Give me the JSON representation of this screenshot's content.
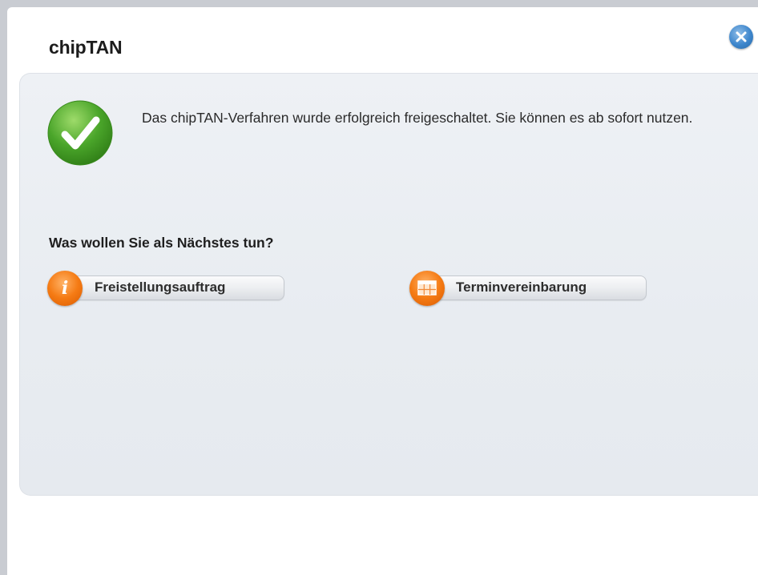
{
  "dialog": {
    "title": "chipTAN",
    "close_icon": "close-icon",
    "success_icon": "checkmark-icon",
    "message": "Das chipTAN-Verfahren wurde erfolgreich freigeschaltet. Sie können es ab sofort nutzen.",
    "question": "Was wollen Sie als Nächstes tun?",
    "actions": [
      {
        "label": "Freistellungsauftrag",
        "icon": "info-icon"
      },
      {
        "label": "Terminvereinbarung",
        "icon": "calendar-icon"
      }
    ]
  },
  "colors": {
    "accent_orange": "#f57b14",
    "success_green": "#4aa52a",
    "close_blue": "#3d86cc",
    "panel_bg": "#eceff3"
  }
}
